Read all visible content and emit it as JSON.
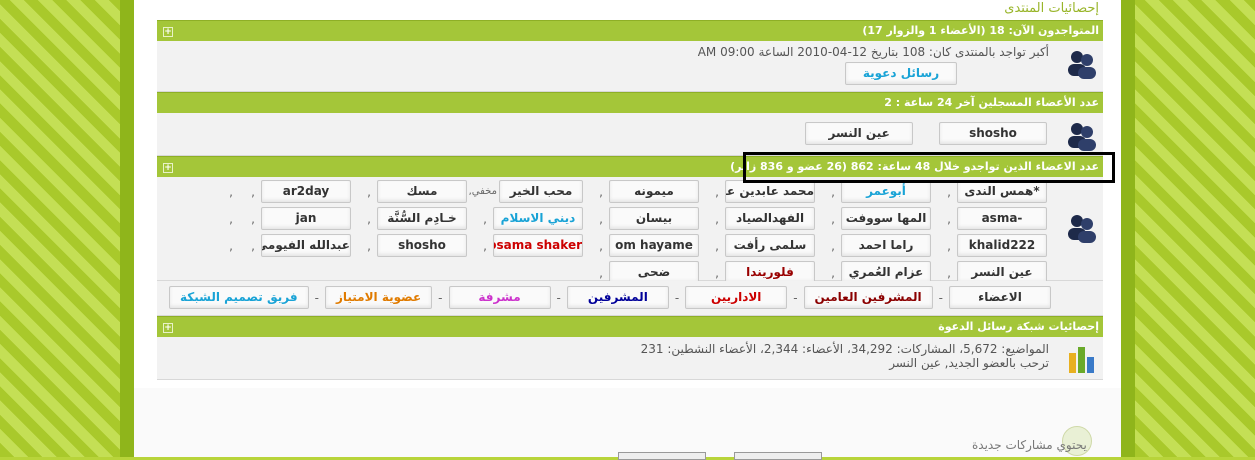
{
  "forum_title": "إحصائيات المنتدى",
  "online": {
    "header": "المتواجدون الآن: 18 (الأعضاء 1 والزوار 17)",
    "max_text": "أكبر تواجد بالمنتدى كان: 108 بتاريخ 12-04-2010 الساعة 09:00 AM",
    "button": "رسائل دعوية"
  },
  "registered24": {
    "header": "عدد الأعضاء المسجلين آخر 24 ساعة : 2",
    "members": [
      "shosho",
      "عين النسر"
    ]
  },
  "visited48": {
    "header": "عدد الاعضاء الذين تواجدو خلال 48 ساعة: 862 (26 عضو و 836 زائر)",
    "members": [
      {
        "name": "*همس الندى",
        "color": "#333333"
      },
      {
        "name": "أبوعمر",
        "color": "#19a3d6"
      },
      {
        "name": "محمد عابدين علي",
        "color": "#333333"
      },
      {
        "name": "ميمونه",
        "color": "#333333"
      },
      {
        "name": "محب الخير",
        "color": "#333333",
        "hidden": "مخفي"
      },
      {
        "name": "مسك",
        "color": "#333333"
      },
      {
        "name": "ar2day",
        "color": "#333333"
      },
      {
        "name": "",
        "color": "#333333",
        "empty": true
      },
      {
        "name": "-asma",
        "color": "#333333"
      },
      {
        "name": "المها سووفت",
        "color": "#333333"
      },
      {
        "name": "الفهدالصياد",
        "color": "#333333"
      },
      {
        "name": "بيسان",
        "color": "#333333"
      },
      {
        "name": "ديني الاسلام",
        "color": "#19a3d6"
      },
      {
        "name": "خـادِم السُّنَّة",
        "color": "#333333"
      },
      {
        "name": "jan",
        "color": "#333333"
      },
      {
        "name": "",
        "color": "#333333",
        "empty": true
      },
      {
        "name": "khalid222",
        "color": "#333333"
      },
      {
        "name": "راما احمد",
        "color": "#333333"
      },
      {
        "name": "سلمى رأفت",
        "color": "#333333"
      },
      {
        "name": "om hayame",
        "color": "#333333"
      },
      {
        "name": "osama shaker",
        "color": "#cc0000"
      },
      {
        "name": "shosho",
        "color": "#333333"
      },
      {
        "name": "عبدالله الفيومي",
        "color": "#333333"
      },
      {
        "name": "",
        "color": "#333333",
        "empty": true
      },
      {
        "name": "عين النسر",
        "color": "#333333"
      },
      {
        "name": "عزام العُمري",
        "color": "#333333"
      },
      {
        "name": "فلوريندا",
        "color": "#990000"
      },
      {
        "name": "ضحى",
        "color": "#333333"
      }
    ]
  },
  "groups": [
    {
      "label": "الاعضاء",
      "color": "#333333"
    },
    {
      "label": "المشرفين العامين",
      "color": "#8b0000"
    },
    {
      "label": "الاداريين",
      "color": "#cc0000"
    },
    {
      "label": "المشرفين",
      "color": "#000099"
    },
    {
      "label": "مشرفة",
      "color": "#cc33cc"
    },
    {
      "label": "عضوية الامتياز",
      "color": "#e07b00"
    },
    {
      "label": "فريق تصميم الشبكة",
      "color": "#19a3d6"
    }
  ],
  "network": {
    "header": "إحصائيات شبكة رسائل الدعوة",
    "stats": "المواضيع: 5,672، المشاركات: 34,292، الأعضاء: 2,344، الأعضاء النشطين: 231",
    "welcome": "ترحب بالعضو الجديد, عين النسر"
  },
  "footer_text": "يحتوي مشاركات جديدة",
  "colors": {
    "bar": "#a4c639",
    "side": "#b8d43a",
    "highlight": "#000000"
  }
}
